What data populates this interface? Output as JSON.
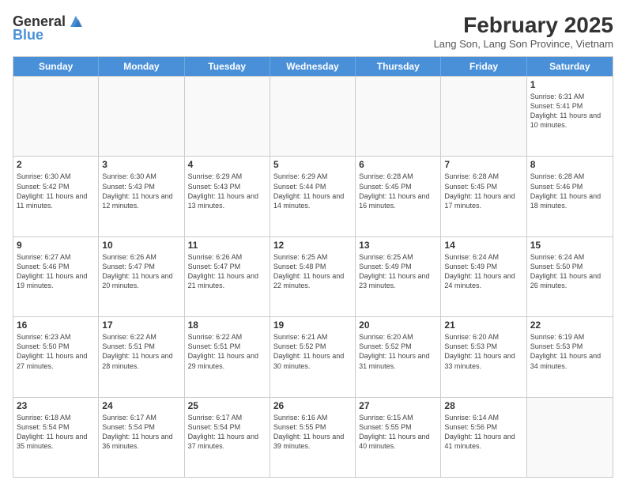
{
  "header": {
    "logo_general": "General",
    "logo_blue": "Blue",
    "month_year": "February 2025",
    "location": "Lang Son, Lang Son Province, Vietnam"
  },
  "weekdays": [
    "Sunday",
    "Monday",
    "Tuesday",
    "Wednesday",
    "Thursday",
    "Friday",
    "Saturday"
  ],
  "weeks": [
    [
      {
        "day": "",
        "text": ""
      },
      {
        "day": "",
        "text": ""
      },
      {
        "day": "",
        "text": ""
      },
      {
        "day": "",
        "text": ""
      },
      {
        "day": "",
        "text": ""
      },
      {
        "day": "",
        "text": ""
      },
      {
        "day": "1",
        "text": "Sunrise: 6:31 AM\nSunset: 5:41 PM\nDaylight: 11 hours and 10 minutes."
      }
    ],
    [
      {
        "day": "2",
        "text": "Sunrise: 6:30 AM\nSunset: 5:42 PM\nDaylight: 11 hours and 11 minutes."
      },
      {
        "day": "3",
        "text": "Sunrise: 6:30 AM\nSunset: 5:43 PM\nDaylight: 11 hours and 12 minutes."
      },
      {
        "day": "4",
        "text": "Sunrise: 6:29 AM\nSunset: 5:43 PM\nDaylight: 11 hours and 13 minutes."
      },
      {
        "day": "5",
        "text": "Sunrise: 6:29 AM\nSunset: 5:44 PM\nDaylight: 11 hours and 14 minutes."
      },
      {
        "day": "6",
        "text": "Sunrise: 6:28 AM\nSunset: 5:45 PM\nDaylight: 11 hours and 16 minutes."
      },
      {
        "day": "7",
        "text": "Sunrise: 6:28 AM\nSunset: 5:45 PM\nDaylight: 11 hours and 17 minutes."
      },
      {
        "day": "8",
        "text": "Sunrise: 6:28 AM\nSunset: 5:46 PM\nDaylight: 11 hours and 18 minutes."
      }
    ],
    [
      {
        "day": "9",
        "text": "Sunrise: 6:27 AM\nSunset: 5:46 PM\nDaylight: 11 hours and 19 minutes."
      },
      {
        "day": "10",
        "text": "Sunrise: 6:26 AM\nSunset: 5:47 PM\nDaylight: 11 hours and 20 minutes."
      },
      {
        "day": "11",
        "text": "Sunrise: 6:26 AM\nSunset: 5:47 PM\nDaylight: 11 hours and 21 minutes."
      },
      {
        "day": "12",
        "text": "Sunrise: 6:25 AM\nSunset: 5:48 PM\nDaylight: 11 hours and 22 minutes."
      },
      {
        "day": "13",
        "text": "Sunrise: 6:25 AM\nSunset: 5:49 PM\nDaylight: 11 hours and 23 minutes."
      },
      {
        "day": "14",
        "text": "Sunrise: 6:24 AM\nSunset: 5:49 PM\nDaylight: 11 hours and 24 minutes."
      },
      {
        "day": "15",
        "text": "Sunrise: 6:24 AM\nSunset: 5:50 PM\nDaylight: 11 hours and 26 minutes."
      }
    ],
    [
      {
        "day": "16",
        "text": "Sunrise: 6:23 AM\nSunset: 5:50 PM\nDaylight: 11 hours and 27 minutes."
      },
      {
        "day": "17",
        "text": "Sunrise: 6:22 AM\nSunset: 5:51 PM\nDaylight: 11 hours and 28 minutes."
      },
      {
        "day": "18",
        "text": "Sunrise: 6:22 AM\nSunset: 5:51 PM\nDaylight: 11 hours and 29 minutes."
      },
      {
        "day": "19",
        "text": "Sunrise: 6:21 AM\nSunset: 5:52 PM\nDaylight: 11 hours and 30 minutes."
      },
      {
        "day": "20",
        "text": "Sunrise: 6:20 AM\nSunset: 5:52 PM\nDaylight: 11 hours and 31 minutes."
      },
      {
        "day": "21",
        "text": "Sunrise: 6:20 AM\nSunset: 5:53 PM\nDaylight: 11 hours and 33 minutes."
      },
      {
        "day": "22",
        "text": "Sunrise: 6:19 AM\nSunset: 5:53 PM\nDaylight: 11 hours and 34 minutes."
      }
    ],
    [
      {
        "day": "23",
        "text": "Sunrise: 6:18 AM\nSunset: 5:54 PM\nDaylight: 11 hours and 35 minutes."
      },
      {
        "day": "24",
        "text": "Sunrise: 6:17 AM\nSunset: 5:54 PM\nDaylight: 11 hours and 36 minutes."
      },
      {
        "day": "25",
        "text": "Sunrise: 6:17 AM\nSunset: 5:54 PM\nDaylight: 11 hours and 37 minutes."
      },
      {
        "day": "26",
        "text": "Sunrise: 6:16 AM\nSunset: 5:55 PM\nDaylight: 11 hours and 39 minutes."
      },
      {
        "day": "27",
        "text": "Sunrise: 6:15 AM\nSunset: 5:55 PM\nDaylight: 11 hours and 40 minutes."
      },
      {
        "day": "28",
        "text": "Sunrise: 6:14 AM\nSunset: 5:56 PM\nDaylight: 11 hours and 41 minutes."
      },
      {
        "day": "",
        "text": ""
      }
    ]
  ]
}
